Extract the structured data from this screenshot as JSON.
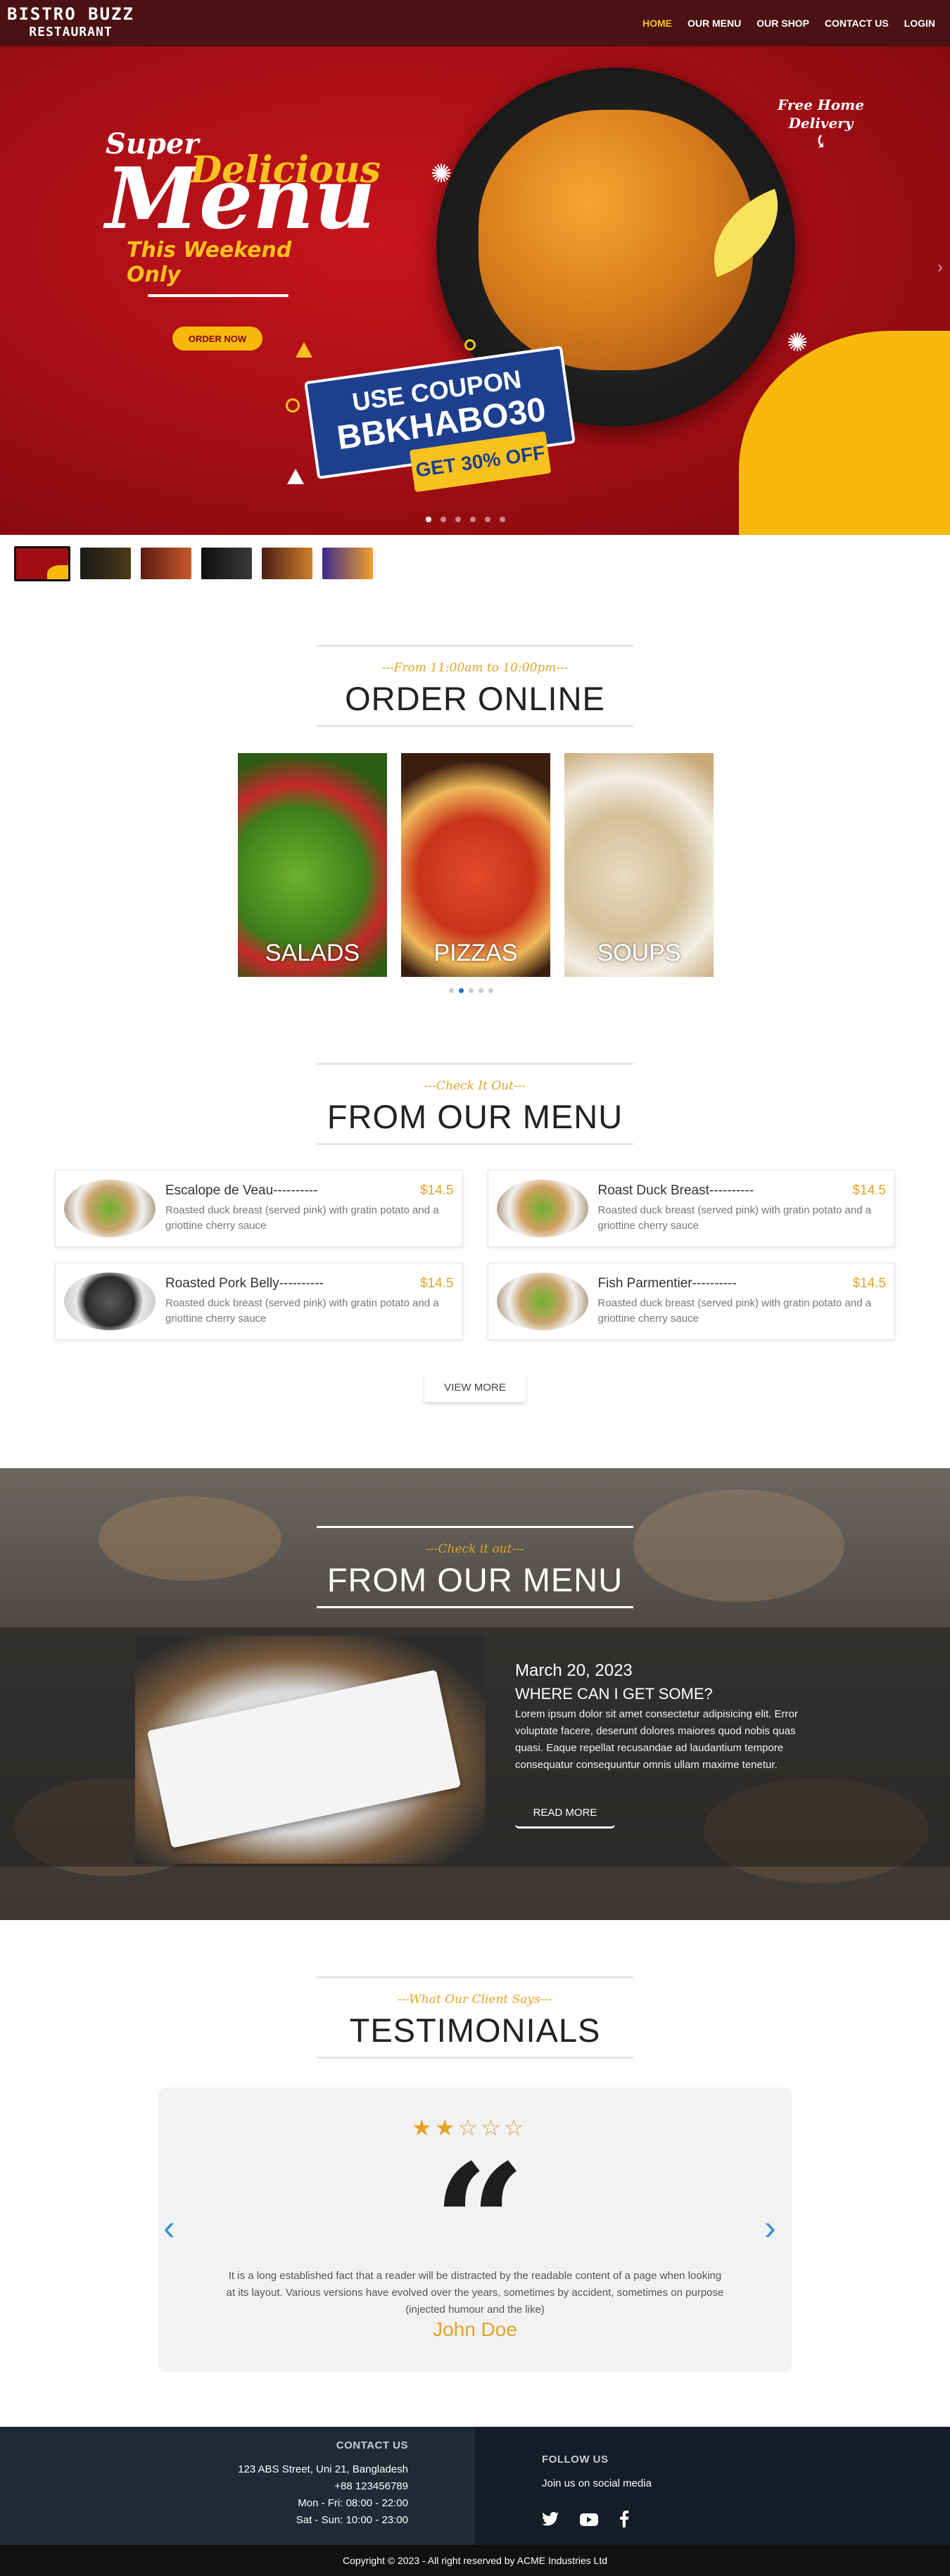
{
  "brand": {
    "line1": "BISTRO BUZZ",
    "line2": "RESTAURANT"
  },
  "nav": [
    {
      "label": "HOME",
      "active": true
    },
    {
      "label": "OUR MENU",
      "active": false
    },
    {
      "label": "OUR SHOP",
      "active": false
    },
    {
      "label": "CONTACT US",
      "active": false
    },
    {
      "label": "LOGIN",
      "active": false
    }
  ],
  "hero": {
    "super": "Super",
    "delicious": "Delicious",
    "menu": "Menu",
    "weekend": "This Weekend Only",
    "order_button": "ORDER NOW",
    "free_delivery_1": "Free Home",
    "free_delivery_2": "Delivery",
    "coupon_line1": "USE COUPON",
    "coupon_code": "BBKHABO30",
    "coupon_tag": "GET 30% OFF",
    "slide_count": 6,
    "active_slide": 0,
    "arrow_icon": "chevron-right-icon"
  },
  "thumbnails": {
    "count": 6,
    "active": 0,
    "colors": [
      "#a10d14",
      "#1a1a1a",
      "#5a1a12",
      "#0f0f0f",
      "#4a1e14",
      "#3b2a8a"
    ]
  },
  "order_online": {
    "subtitle": "---From 11:00am to 10:00pm---",
    "title": "ORDER ONLINE",
    "cards": [
      {
        "label": "SALADS"
      },
      {
        "label": "PIZZAS"
      },
      {
        "label": "SOUPS"
      }
    ],
    "dots": 5,
    "active_dot": 1
  },
  "from_menu": {
    "subtitle": "---Check It Out---",
    "title": "FROM OUR MENU",
    "items": [
      {
        "name": "Escalope de Veau----------",
        "price": "$14.5",
        "desc": "Roasted duck breast (served pink) with gratin potato and a griottine cherry sauce"
      },
      {
        "name": "Roast Duck Breast----------",
        "price": "$14.5",
        "desc": "Roasted duck breast (served pink) with gratin potato and a griottine cherry sauce"
      },
      {
        "name": "Roasted Pork Belly----------",
        "price": "$14.5",
        "desc": "Roasted duck breast (served pink) with gratin potato and a griottine cherry sauce"
      },
      {
        "name": "Fish Parmentier----------",
        "price": "$14.5",
        "desc": "Roasted duck breast (served pink) with gratin potato and a griottine cherry sauce"
      }
    ],
    "view_more": "VIEW MORE"
  },
  "featured": {
    "subtitle": "---Check it out---",
    "title": "FROM OUR MENU",
    "date": "March 20, 2023",
    "heading": "WHERE CAN I GET SOME?",
    "para": "Lorem ipsum dolor sit amet consectetur adipisicing elit. Error voluptate facere, deserunt dolores maiores quod nobis quas quasi. Eaque repellat recusandae ad laudantium tempore consequatur consequuntur omnis ullam maxime tenetur.",
    "read_more": "READ MORE"
  },
  "testimonials": {
    "subtitle": "---What Our Client Says---",
    "title": "TESTIMONIALS",
    "rating": 2,
    "rating_max": 5,
    "quote_icon": "quote-icon",
    "text": "It is a long established fact that a reader will be distracted by the readable content of a page when looking at its layout. Various versions have evolved over the years, sometimes by accident, sometimes on purpose (injected humour and the like)",
    "name": "John Doe",
    "prev_icon": "chevron-left-icon",
    "next_icon": "chevron-right-icon"
  },
  "footer": {
    "contact_title": "CONTACT US",
    "address": "123 ABS Street, Uni 21, Bangladesh",
    "phone": "+88 123456789",
    "hours_weekday": "Mon - Fri: 08:00 - 22:00",
    "hours_weekend": "Sat - Sun: 10:00 - 23:00",
    "follow_title": "FOLLOW US",
    "follow_text": "Join us on social media",
    "socials": [
      "twitter-icon",
      "youtube-icon",
      "facebook-icon"
    ],
    "copyright": "Copyright © 2023 - All right reserved by ACME Industries Ltd"
  },
  "colors": {
    "nav_bg": "#4a1212",
    "accent": "#f5c518",
    "gold": "#e0a526",
    "hero_red": "#a10d14",
    "footer_left": "#1f2937",
    "footer_right": "#141c28"
  }
}
